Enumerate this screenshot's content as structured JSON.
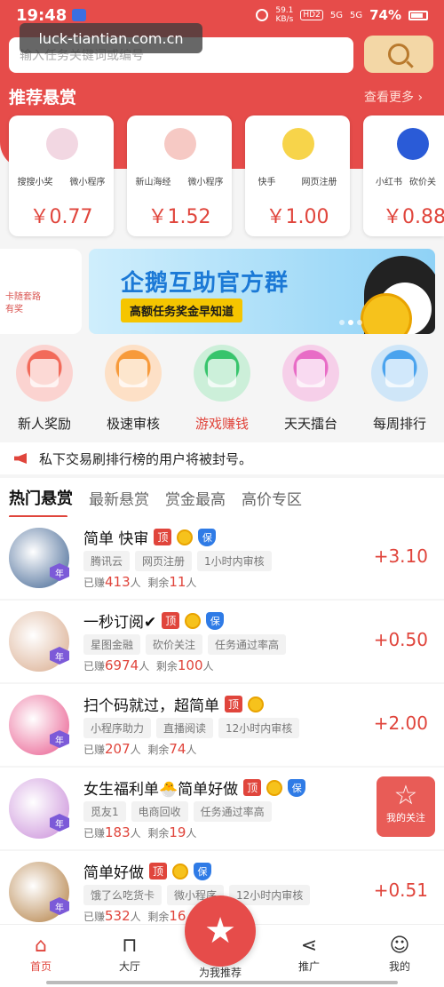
{
  "status_bar": {
    "time": "19:48",
    "speed_value": "59.1",
    "speed_unit": "KB/s",
    "hd": "HD2",
    "sig1": "5G",
    "sig2": "5G",
    "battery": "74%"
  },
  "watermark": "luck-tiantian.com.cn",
  "search": {
    "placeholder": "输入任务关键词或编号"
  },
  "recommend": {
    "title": "推荐悬赏",
    "more": "查看更多 ›",
    "cards": [
      {
        "tag1": "搜搜小奖",
        "tag2": "微小程序",
        "price": "￥0.77",
        "color": "#f2d7e2"
      },
      {
        "tag1": "新山海经",
        "tag2": "微小程序",
        "price": "￥1.52",
        "color": "#f6c9c4"
      },
      {
        "tag1": "快手",
        "tag2": "网页注册",
        "price": "￥1.00",
        "color": "#f7d44a"
      },
      {
        "tag1": "小红书",
        "tag2": "砍价关",
        "price": "￥0.88",
        "color": "#2a5bd7"
      }
    ]
  },
  "banner": {
    "left_line1": "卡随套路",
    "left_line2": "有奖",
    "title": "企鹅互助官方群",
    "subtitle": "高额任务奖金早知道"
  },
  "quick_icons": [
    {
      "label": "新人奖励",
      "color": "#fbd3d0",
      "inner": "#f26a5a",
      "active": false
    },
    {
      "label": "极速审核",
      "color": "#fde0c6",
      "inner": "#f79a3a",
      "active": false
    },
    {
      "label": "游戏赚钱",
      "color": "#ccefd9",
      "inner": "#37c46c",
      "active": true
    },
    {
      "label": "天天擂台",
      "color": "#f6cfe9",
      "inner": "#e86cc6",
      "active": false
    },
    {
      "label": "每周排行",
      "color": "#cfe6f8",
      "inner": "#4aa3ee",
      "active": false
    }
  ],
  "notice": "私下交易刷排行榜的用户将被封号。",
  "tabs": [
    "热门悬赏",
    "最新悬赏",
    "赏金最高",
    "高价专区"
  ],
  "tasks": [
    {
      "title": "简单 快审",
      "ding": "顶",
      "bao": "保",
      "tags": [
        "腾讯云",
        "网页注册",
        "1小时内审核"
      ],
      "earned_label": "已赚",
      "earned": "413",
      "earned_unit": "人",
      "left_label": "剩余",
      "left": "11",
      "left_unit": "人",
      "price": "+3.10",
      "year": "年",
      "color": "#3a5f8f"
    },
    {
      "title": "一秒订阅✔",
      "ding": "顶",
      "bao": "保",
      "tags": [
        "星图金融",
        "砍价关注",
        "任务通过率高"
      ],
      "earned_label": "已赚",
      "earned": "6974",
      "earned_unit": "人",
      "left_label": "剩余",
      "left": "100",
      "left_unit": "人",
      "price": "+0.50",
      "year": "年",
      "color": "#d8a98a"
    },
    {
      "title": "扫个码就过，超简单",
      "ding": "顶",
      "bao": "",
      "tags": [
        "小程序助力",
        "直播阅读",
        "12小时内审核"
      ],
      "earned_label": "已赚",
      "earned": "207",
      "earned_unit": "人",
      "left_label": "剩余",
      "left": "74",
      "left_unit": "人",
      "price": "+2.00",
      "year": "年",
      "color": "#e8558a"
    },
    {
      "title": "女生福利单🐣简单好做",
      "ding": "顶",
      "bao": "保",
      "tags": [
        "觅友1",
        "电商回收",
        "任务通过率高"
      ],
      "earned_label": "已赚",
      "earned": "183",
      "earned_unit": "人",
      "left_label": "剩余",
      "left": "19",
      "left_unit": "人",
      "price": "",
      "year": "年",
      "color": "#c88ad8"
    },
    {
      "title": "简单好做",
      "ding": "顶",
      "bao": "保",
      "tags": [
        "饿了么吃货卡",
        "微小程序",
        "12小时内审核"
      ],
      "earned_label": "已赚",
      "earned": "532",
      "earned_unit": "人",
      "left_label": "剩余",
      "left": "16",
      "left_unit": "",
      "price": "+0.51",
      "year": "年",
      "color": "#b07a3c"
    }
  ],
  "fav": {
    "label": "我的关注"
  },
  "nav": {
    "home": "首页",
    "hall": "大厅",
    "recommend": "为我推荐",
    "promote": "推广",
    "mine": "我的"
  }
}
